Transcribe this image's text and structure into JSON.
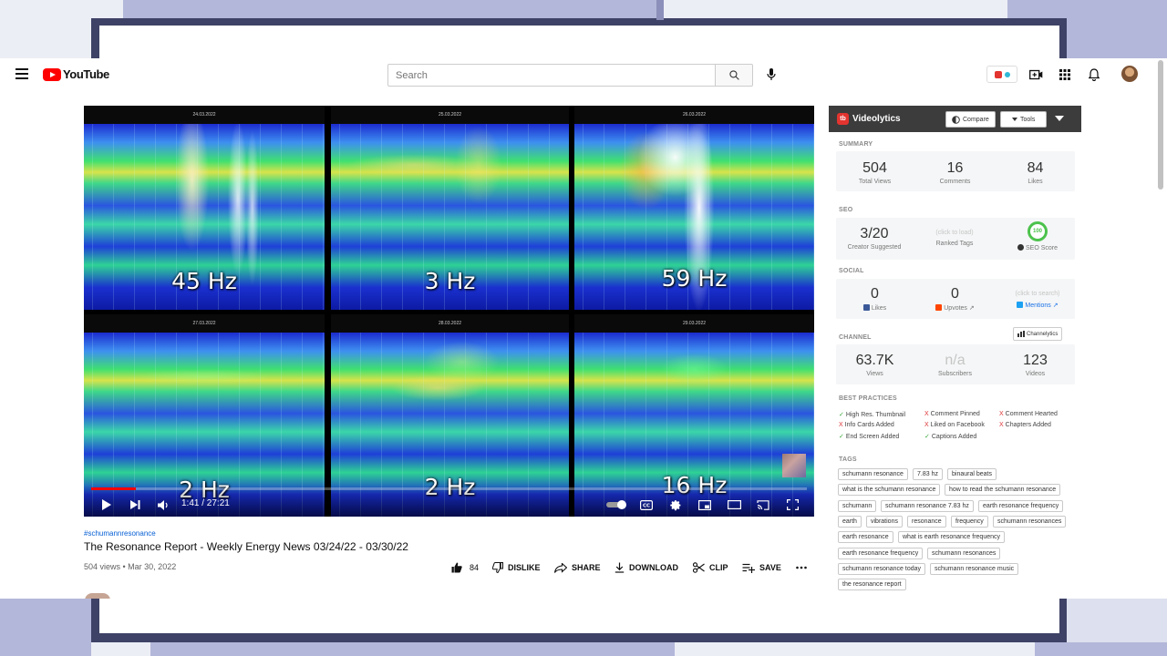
{
  "header": {
    "logo_text": "YouTube",
    "search_placeholder": "Search"
  },
  "video": {
    "panels": [
      {
        "date": "24.03.2022",
        "hz": "45 Hz"
      },
      {
        "date": "25.03.2022",
        "hz": "3 Hz"
      },
      {
        "date": "26.03.2022",
        "hz": "59 Hz"
      },
      {
        "date": "27.03.2022",
        "hz": "2 Hz"
      },
      {
        "date": "28.03.2022",
        "hz": "2 Hz"
      },
      {
        "date": "29.03.2022",
        "hz": "16 Hz"
      }
    ],
    "time": "1:41 / 27:21",
    "progress_fraction": 0.062
  },
  "meta": {
    "hashtag": "#schumannresonance",
    "title": "The Resonance Report - Weekly Energy News 03/24/22 - 03/30/22",
    "views_date": "504 views • Mar 30, 2022",
    "like_count": "84",
    "dislike": "DISLIKE",
    "share": "SHARE",
    "download": "DOWNLOAD",
    "clip": "CLIP",
    "save": "SAVE"
  },
  "videolytics": {
    "title": "Videolytics",
    "compare": "Compare",
    "tools": "Tools",
    "summary_label": "SUMMARY",
    "summary": [
      {
        "num": "504",
        "label": "Total Views"
      },
      {
        "num": "16",
        "label": "Comments"
      },
      {
        "num": "84",
        "label": "Likes"
      }
    ],
    "seo_label": "SEO",
    "seo": {
      "suggested": "3/20",
      "suggested_label": "Creator Suggested",
      "ranked_hint": "(click to load)",
      "ranked_label": "Ranked Tags",
      "score": "100",
      "score_label": "SEO Score"
    },
    "social_label": "SOCIAL",
    "social": {
      "likes": "0",
      "likes_label": "Likes",
      "upvotes": "0",
      "upvotes_label": "Upvotes",
      "mentions_hint": "(click to search)",
      "mentions_label": "Mentions"
    },
    "channel_label": "CHANNEL",
    "channelytics": "Channelytics",
    "channel": {
      "views": "63.7K",
      "views_label": "Views",
      "subs": "n/a",
      "subs_label": "Subscribers",
      "videos": "123",
      "videos_label": "Videos"
    },
    "bp_label": "BEST PRACTICES",
    "best_practices": [
      {
        "text": "High Res. Thumbnail",
        "mark": "✓"
      },
      {
        "text": "Comment Pinned",
        "mark": "X"
      },
      {
        "text": "Comment Hearted",
        "mark": "X"
      },
      {
        "text": "Info Cards Added",
        "mark": "X"
      },
      {
        "text": "Liked on Facebook",
        "mark": "X"
      },
      {
        "text": "Chapters Added",
        "mark": "X"
      },
      {
        "text": "End Screen Added",
        "mark": "✓"
      },
      {
        "text": "Captions Added",
        "mark": "✓"
      }
    ],
    "tags_label": "TAGS",
    "tags": [
      "schumann resonance",
      "7.83 hz",
      "binaural beats",
      "what is the schumann resonance",
      "how to read the schumann resonance",
      "schumann",
      "schumann resonance 7.83 hz",
      "earth resonance frequency",
      "earth",
      "vibrations",
      "resonance",
      "frequency",
      "schumann resonances",
      "earth resonance",
      "what is earth resonance frequency",
      "earth resonance frequency",
      "schumann resonances",
      "schumann resonance today",
      "schumann resonance music",
      "the resonance report"
    ]
  }
}
